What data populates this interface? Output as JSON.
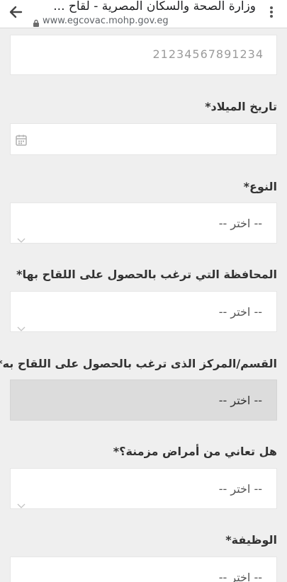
{
  "browser": {
    "title": "وزارة الصحة والسكان المصرية - لقاح ...",
    "url": "www.egcovac.mohp.gov.eg",
    "icons": {
      "back": "back-arrow-icon",
      "lock": "lock-icon",
      "menu": "more-vert-icon"
    }
  },
  "form": {
    "id_value": "21234567891234",
    "birthdate_label": "تاريخ الميلاد*",
    "gender_label": "النوع*",
    "gender_placeholder": "-- اختر --",
    "governorate_label": "المحافظة التي ترغب بالحصول على اللقاح بها*",
    "governorate_placeholder": "-- اختر --",
    "center_label": "القسم/المركز الذى ترغب بالحصول على اللقاح به*",
    "center_placeholder": "-- اختر --",
    "chronic_label": "هل تعاني من أمراض مزمنة؟*",
    "chronic_placeholder": "-- اختر --",
    "job_label": "الوظيفة*",
    "job_placeholder": "-- اختر --"
  },
  "colors": {
    "page_background": "#efefef",
    "field_background": "#ffffff",
    "disabled_field_background": "#dcdcdc",
    "label_text": "#333333",
    "placeholder_text": "#9b9b9b"
  }
}
